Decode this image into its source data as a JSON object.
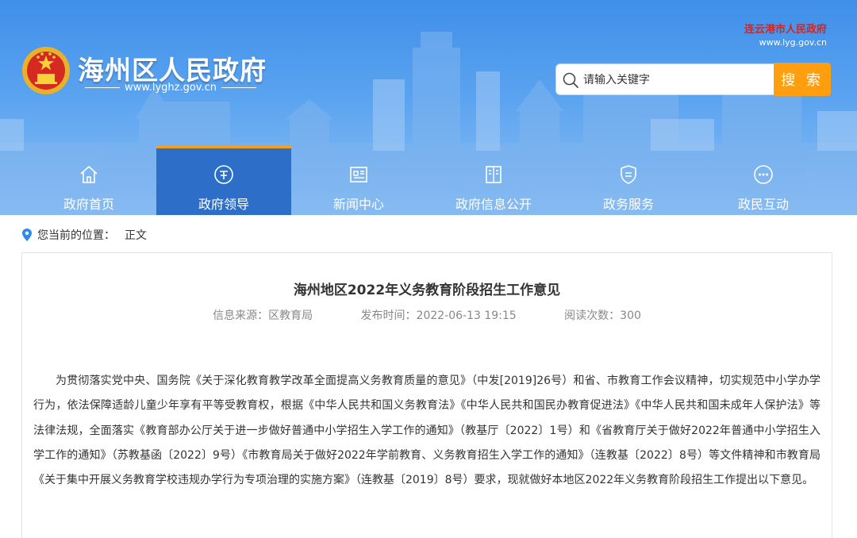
{
  "header": {
    "site_title": "海州区人民政府",
    "site_url": "www.lyghz.gov.cn",
    "city_name": "连云港市人民政府",
    "city_url": "www.lyg.gov.cn",
    "emblem_icon": "national-emblem-icon",
    "colors": {
      "sky": "#4b97ec",
      "nav_active": "#2d6fc8",
      "accent": "#ff9f10",
      "city_name": "#d9231d"
    }
  },
  "search": {
    "placeholder": "请输入关键字",
    "button_label": "搜 索"
  },
  "nav": {
    "items": [
      {
        "label": "政府首页",
        "icon": "home-icon"
      },
      {
        "label": "政府领导",
        "icon": "leader-icon"
      },
      {
        "label": "新闻中心",
        "icon": "news-icon"
      },
      {
        "label": "政府信息公开",
        "icon": "book-icon"
      },
      {
        "label": "政务服务",
        "icon": "shield-icon"
      },
      {
        "label": "政民互动",
        "icon": "chat-icon"
      }
    ],
    "active_index": 1
  },
  "breadcrumb": {
    "prefix": "您当前的位置：",
    "current": "正文"
  },
  "article": {
    "title": "海州地区2022年义务教育阶段招生工作意见",
    "source": "信息来源：区教育局",
    "published": "发布时间：2022-06-13 19:15",
    "views": "阅读次数：300",
    "body": "为贯彻落实党中央、国务院《关于深化教育教学改革全面提高义务教育质量的意见》（中发[2019]26号）和省、市教育工作会议精神，切实规范中小学办学行为，依法保障适龄儿童少年享有平等受教育权，根据《中华人民共和国义务教育法》《中华人民共和国民办教育促进法》《中华人民共和国未成年人保护法》等法律法规，全面落实《教育部办公厅关于进一步做好普通中小学招生入学工作的通知》（教基厅〔2022〕1号）和《省教育厅关于做好2022年普通中小学招生入学工作的通知》（苏教基函〔2022〕9号）《市教育局关于做好2022年学前教育、义务教育招生入学工作的通知》（连教基〔2022〕8号）等文件精神和市教育局《关于集中开展义务教育学校违规办学行为专项治理的实施方案》（连教基〔2019〕8号）要求，现就做好本地区2022年义务教育阶段招生工作提出以下意见。"
  }
}
